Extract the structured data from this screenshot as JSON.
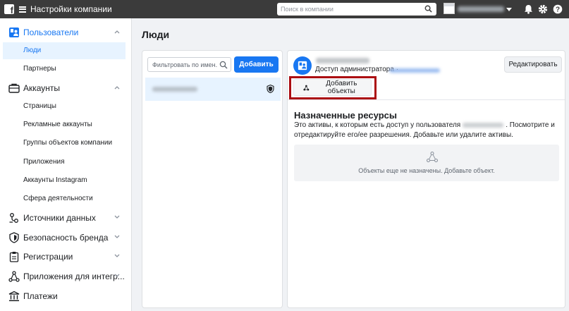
{
  "topbar": {
    "title": "Настройки компании",
    "search_placeholder": "Поиск в компании",
    "icons": [
      "facebook-logo-icon",
      "menu-icon",
      "search-icon",
      "bell-icon",
      "gear-icon",
      "help-icon"
    ]
  },
  "sidebar": {
    "sections": [
      {
        "label": "Пользователи",
        "icon": "users-icon",
        "expanded": true
      },
      {
        "label": "Аккаунты",
        "icon": "briefcase-icon",
        "expanded": true
      },
      {
        "label": "Источники данных",
        "icon": "data-sources-icon",
        "expanded": false
      },
      {
        "label": "Безопасность бренда",
        "icon": "shield-icon",
        "expanded": false
      },
      {
        "label": "Регистрации",
        "icon": "clipboard-icon",
        "expanded": false
      },
      {
        "label": "Приложения для интегр...",
        "icon": "integrations-icon",
        "expanded": false
      },
      {
        "label": "Платежи",
        "icon": "payments-icon",
        "expanded": false
      }
    ],
    "users_items": [
      "Люди",
      "Партнеры"
    ],
    "accounts_items": [
      "Страницы",
      "Рекламные аккаунты",
      "Группы объектов компании",
      "Приложения",
      "Аккаунты Instagram",
      "Сфера деятельности"
    ],
    "active_item": "Люди"
  },
  "main": {
    "title": "Люди",
    "filter_placeholder": "Фильтровать по имен...",
    "add_button": "Добавить"
  },
  "detail": {
    "access_label": "Доступ администратора ·",
    "edit_button": "Редактировать",
    "add_objects_button": "Добавить объекты",
    "resources_title": "Назначенные ресурсы",
    "resources_desc_before": "Это активы, к которым есть доступ у пользователя",
    "resources_desc_after": ". Посмотрите и отредактируйте его/ее разрешения. Добавьте или удалите активы.",
    "empty_text": "Объекты еще не назначены. Добавьте объект."
  },
  "colors": {
    "accent": "#1877f2",
    "topbar": "#3b3b3b",
    "highlight": "#ab0d12"
  }
}
